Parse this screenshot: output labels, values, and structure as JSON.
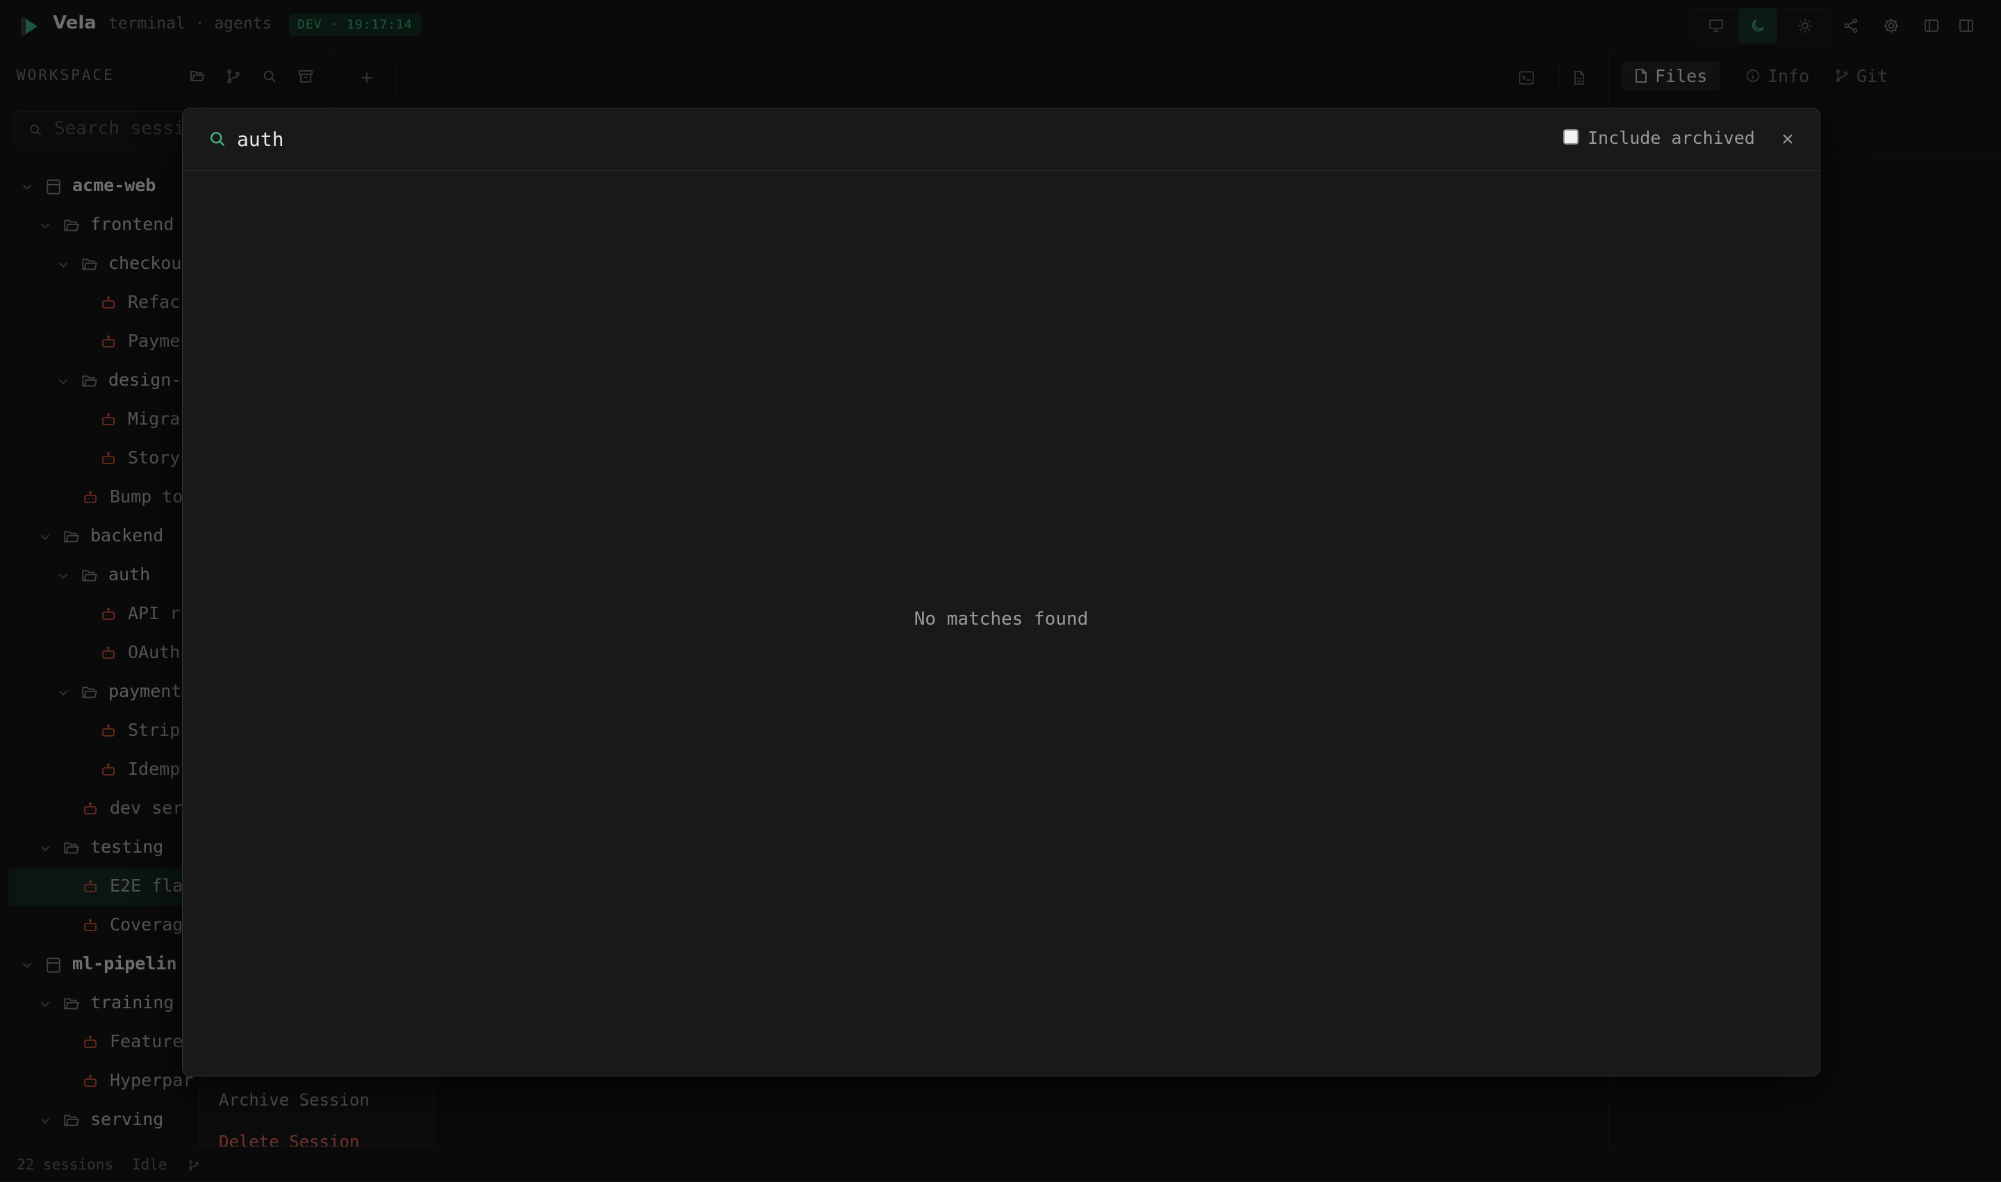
{
  "app": {
    "name": "Vela",
    "subtitle": "terminal · agents",
    "env_badge": "DEV · 19:17:14"
  },
  "colors": {
    "accent": "#3fae7c",
    "session_icon": "#d4583b",
    "danger": "#e0655a"
  },
  "top_actions": {
    "theme_options": [
      "monitor-icon",
      "moon-icon",
      "sun-icon"
    ],
    "active_theme": "moon-icon",
    "tools": [
      "share-icon",
      "settings-icon",
      "left-panel-icon",
      "right-panel-icon"
    ]
  },
  "sidebar": {
    "title": "WORKSPACE",
    "toolbar_icons": [
      "folder-open-icon",
      "git-branch-icon",
      "search-icon",
      "archive-icon"
    ],
    "search_placeholder": "Search sessi",
    "tree": [
      {
        "type": "project",
        "label": "acme-web",
        "depth": 0
      },
      {
        "type": "folder",
        "label": "frontend",
        "depth": 1
      },
      {
        "type": "folder",
        "label": "checkou",
        "depth": 2
      },
      {
        "type": "session",
        "label": "Refac",
        "depth": 3
      },
      {
        "type": "session",
        "label": "Payme",
        "depth": 3
      },
      {
        "type": "folder",
        "label": "design-",
        "depth": 2
      },
      {
        "type": "session",
        "label": "Migra",
        "depth": 3
      },
      {
        "type": "session",
        "label": "Story",
        "depth": 3
      },
      {
        "type": "session",
        "label": "Bump to",
        "depth": 2
      },
      {
        "type": "folder",
        "label": "backend",
        "depth": 1
      },
      {
        "type": "folder",
        "label": "auth",
        "depth": 2
      },
      {
        "type": "session",
        "label": "API r",
        "depth": 3
      },
      {
        "type": "session",
        "label": "OAuth",
        "depth": 3
      },
      {
        "type": "folder",
        "label": "payment",
        "depth": 2
      },
      {
        "type": "session",
        "label": "Strip",
        "depth": 3
      },
      {
        "type": "session",
        "label": "Idemp",
        "depth": 3
      },
      {
        "type": "session",
        "label": "dev ser",
        "depth": 2
      },
      {
        "type": "folder",
        "label": "testing",
        "depth": 1
      },
      {
        "type": "session",
        "label": "E2E fla",
        "depth": 2,
        "active": true
      },
      {
        "type": "session",
        "label": "Coverag",
        "depth": 2
      },
      {
        "type": "project",
        "label": "ml-pipelin",
        "depth": 0
      },
      {
        "type": "folder",
        "label": "training",
        "depth": 1
      },
      {
        "type": "session",
        "label": "Feature",
        "depth": 2
      },
      {
        "type": "session",
        "label": "Hyperpar",
        "depth": 2
      },
      {
        "type": "folder",
        "label": "serving",
        "depth": 1
      }
    ]
  },
  "context_menu": {
    "archive_label": "Archive Session",
    "delete_label": "Delete Session"
  },
  "status_bar": {
    "session_count": "22 sessions",
    "state": "Idle"
  },
  "right_panel": {
    "tabs": [
      {
        "label": "Files",
        "icon": "file-icon",
        "active": true
      },
      {
        "label": "Info",
        "icon": "info-icon",
        "active": false
      },
      {
        "label": "Git",
        "icon": "git-branch-icon",
        "active": false
      }
    ]
  },
  "search_modal": {
    "query": "auth",
    "include_archived_label": "Include archived",
    "include_archived_checked": false,
    "empty_message": "No matches found"
  }
}
